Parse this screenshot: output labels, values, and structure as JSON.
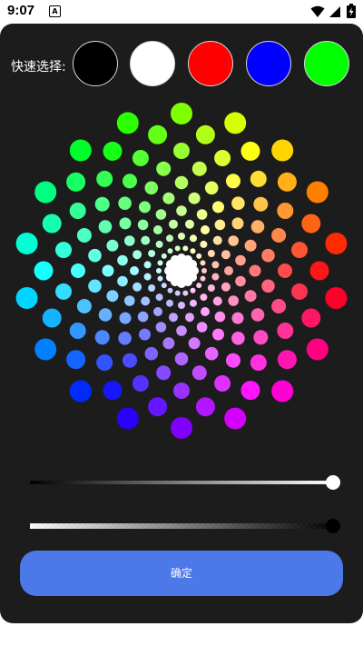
{
  "status_bar": {
    "time": "9:07",
    "app_badge": "A",
    "wifi_icon": "wifi-icon",
    "signal_icon": "signal-icon",
    "battery_icon": "battery-charging-icon"
  },
  "picker": {
    "quick_select_label": "快速选择:",
    "quick_swatches": [
      {
        "name": "black",
        "color": "#000000"
      },
      {
        "name": "white",
        "color": "#ffffff"
      },
      {
        "name": "red",
        "color": "#ff0000"
      },
      {
        "name": "blue",
        "color": "#0000ff"
      },
      {
        "name": "green",
        "color": "#00ff00"
      }
    ],
    "brightness_slider": {
      "value": 1.0,
      "thumb_color": "#ffffff"
    },
    "alpha_slider": {
      "value": 1.0,
      "thumb_color": "#000000"
    },
    "confirm_label": "确定",
    "accent_color": "#4c78e8",
    "panel_color": "#1c1c1c",
    "selected_color": "#ffffff"
  }
}
